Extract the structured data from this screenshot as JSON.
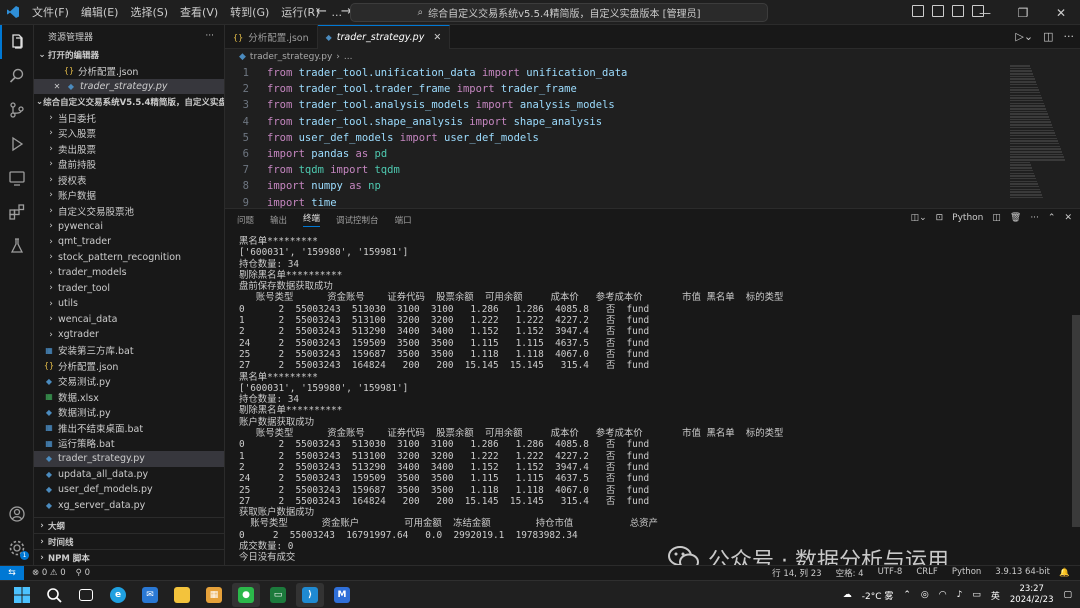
{
  "titlebar": {
    "menu": [
      "文件(F)",
      "编辑(E)",
      "选择(S)",
      "查看(V)",
      "转到(G)",
      "运行(R)",
      "..."
    ],
    "search_text": "综合自定义交易系统v5.5.4精简版，自定义实盘版本 [管理员]"
  },
  "sidebar": {
    "header": "资源管理器",
    "open_editors_label": "打开的编辑器",
    "open_editors": [
      {
        "label": "分析配置.json",
        "icon": "json-icon"
      },
      {
        "label": "trader_strategy.py",
        "icon": "python-icon"
      }
    ],
    "project_label": "综合自定义交易系统V5.5.4精简版，自定义实盘...",
    "folders": [
      "当日委托",
      "买入股票",
      "卖出股票",
      "盘前持股",
      "授权表",
      "账户数据",
      "自定义交易股票池",
      "pywencai",
      "qmt_trader",
      "stock_pattern_recognition",
      "trader_models",
      "trader_tool",
      "utils",
      "wencai_data",
      "xgtrader"
    ],
    "files": [
      {
        "label": "安装第三方库.bat",
        "icon": "bat-icon"
      },
      {
        "label": "分析配置.json",
        "icon": "json-icon"
      },
      {
        "label": "交易测试.py",
        "icon": "python-icon"
      },
      {
        "label": "数据.xlsx",
        "icon": "excel-icon"
      },
      {
        "label": "数据测试.py",
        "icon": "python-icon"
      },
      {
        "label": "推出不结束桌面.bat",
        "icon": "bat-icon"
      },
      {
        "label": "运行策略.bat",
        "icon": "bat-icon"
      },
      {
        "label": "trader_strategy.py",
        "icon": "python-icon"
      },
      {
        "label": "updata_all_data.py",
        "icon": "python-icon"
      },
      {
        "label": "user_def_models.py",
        "icon": "python-icon"
      },
      {
        "label": "xg_server_data.py",
        "icon": "python-icon"
      }
    ],
    "bottom_sections": [
      "大纲",
      "时间线",
      "NPM 脚本"
    ]
  },
  "tabs": [
    {
      "label": "分析配置.json",
      "active": false
    },
    {
      "label": "trader_strategy.py",
      "active": true
    }
  ],
  "breadcrumb": {
    "file": "trader_strategy.py",
    "more": "..."
  },
  "code_lines": [
    [
      {
        "t": "from ",
        "c": "kw"
      },
      {
        "t": "trader_tool.unification_data ",
        "c": "id"
      },
      {
        "t": "import ",
        "c": "kw"
      },
      {
        "t": "unification_data",
        "c": "id"
      }
    ],
    [
      {
        "t": "from ",
        "c": "kw"
      },
      {
        "t": "trader_tool.trader_frame ",
        "c": "id"
      },
      {
        "t": "import ",
        "c": "kw"
      },
      {
        "t": "trader_frame",
        "c": "id"
      }
    ],
    [
      {
        "t": "from ",
        "c": "kw"
      },
      {
        "t": "trader_tool.analysis_models ",
        "c": "id"
      },
      {
        "t": "import ",
        "c": "kw"
      },
      {
        "t": "analysis_models",
        "c": "id"
      }
    ],
    [
      {
        "t": "from ",
        "c": "kw"
      },
      {
        "t": "trader_tool.shape_analysis ",
        "c": "id"
      },
      {
        "t": "import ",
        "c": "kw"
      },
      {
        "t": "shape_analysis",
        "c": "id"
      }
    ],
    [
      {
        "t": "from ",
        "c": "kw"
      },
      {
        "t": "user_def_models ",
        "c": "id"
      },
      {
        "t": "import ",
        "c": "kw"
      },
      {
        "t": "user_def_models",
        "c": "id"
      }
    ],
    [
      {
        "t": "import ",
        "c": "kw"
      },
      {
        "t": "pandas ",
        "c": "id"
      },
      {
        "t": "as ",
        "c": "kw"
      },
      {
        "t": "pd",
        "c": "mod"
      }
    ],
    [
      {
        "t": "from ",
        "c": "kw"
      },
      {
        "t": "tqdm ",
        "c": "mod"
      },
      {
        "t": "import ",
        "c": "kw"
      },
      {
        "t": "tqdm",
        "c": "mod"
      }
    ],
    [
      {
        "t": "import ",
        "c": "kw"
      },
      {
        "t": "numpy ",
        "c": "id"
      },
      {
        "t": "as ",
        "c": "kw"
      },
      {
        "t": "np",
        "c": "mod"
      }
    ],
    [
      {
        "t": "import ",
        "c": "kw"
      },
      {
        "t": "time",
        "c": "id"
      }
    ]
  ],
  "panel": {
    "tabs": [
      "问题",
      "输出",
      "终端",
      "调试控制台",
      "端口"
    ],
    "active_tab": "终端",
    "shell": "Python"
  },
  "terminal_lines": [
    "黑名单*********",
    "['600031', '159980', '159981']",
    "持仓数量: 34",
    "剔除黑名单**********",
    "盘前保存数据获取成功",
    "   账号类型      资金账号    证券代码  股票余额  可用余额     成本价   参考成本价       市值 黑名单  标的类型",
    "0      2  55003243  513030  3100  3100   1.286   1.286  4085.8   否  fund",
    "1      2  55003243  513100  3200  3200   1.222   1.222  4227.2   否  fund",
    "2      2  55003243  513290  3400  3400   1.152   1.152  3947.4   否  fund",
    "24     2  55003243  159509  3500  3500   1.115   1.115  4637.5   否  fund",
    "25     2  55003243  159687  3500  3500   1.118   1.118  4067.0   否  fund",
    "27     2  55003243  164824   200   200  15.145  15.145   315.4   否  fund",
    "黑名单*********",
    "['600031', '159980', '159981']",
    "持仓数量: 34",
    "剔除黑名单**********",
    "账户数据获取成功",
    "   账号类型      资金账号    证券代码  股票余额  可用余额     成本价   参考成本价       市值 黑名单  标的类型",
    "0      2  55003243  513030  3100  3100   1.286   1.286  4085.8   否  fund",
    "1      2  55003243  513100  3200  3200   1.222   1.222  4227.2   否  fund",
    "2      2  55003243  513290  3400  3400   1.152   1.152  3947.4   否  fund",
    "24     2  55003243  159509  3500  3500   1.115   1.115  4637.5   否  fund",
    "25     2  55003243  159687  3500  3500   1.118   1.118  4067.0   否  fund",
    "27     2  55003243  164824   200   200  15.145  15.145   315.4   否  fund",
    "获取账户数据成功",
    "  账号类型      资金账户        可用金额  冻结金额        持仓市值          总资产",
    "0     2  55003243  16791997.64   0.0  2992019.1  19783982.34",
    "成交数量: 0",
    "今日没有成交"
  ],
  "watermark": "公众号 · 数据分析与运用",
  "statusbar": {
    "errors": "⊗ 0  ⚠ 0",
    "ports": "⚲ 0",
    "cursor": "行 14, 列 23",
    "spaces": "空格: 4",
    "encoding": "UTF-8",
    "eol": "CRLF",
    "language": "Python",
    "interpreter": "3.9.13 64-bit"
  },
  "taskbar": {
    "weather": "-2°C 雾",
    "ime": "英",
    "time": "23:27",
    "date": "2024/2/23"
  },
  "colors": {
    "accent": "#0078d4",
    "keyword": "#c586c0",
    "identifier": "#9cdcfe",
    "module": "#4ec9b0"
  }
}
